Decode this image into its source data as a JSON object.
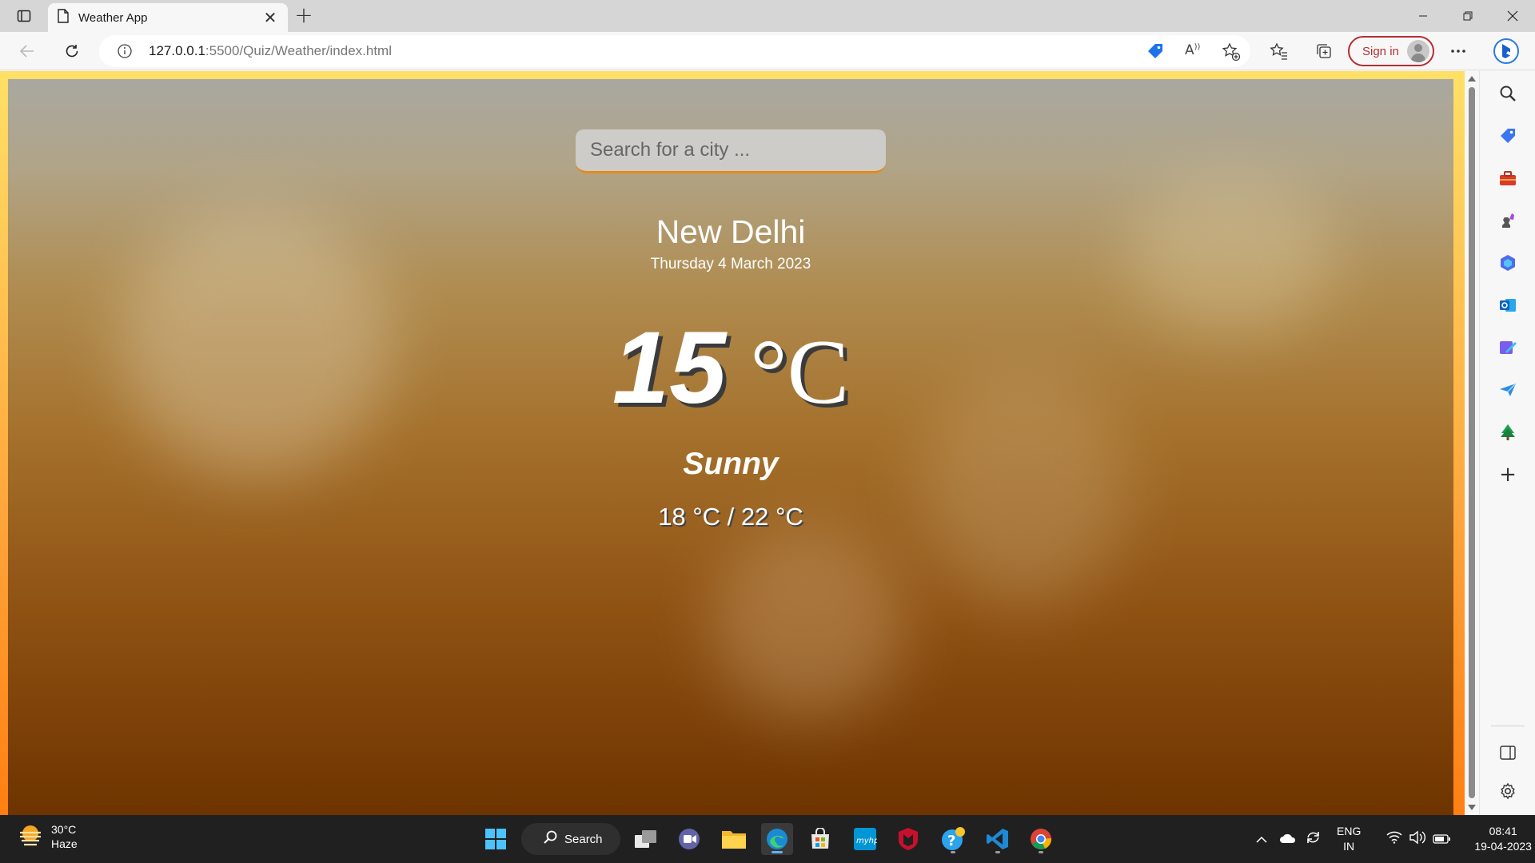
{
  "browser": {
    "tab_title": "Weather App",
    "url_host": "127.0.0.1",
    "url_path": ":5500/Quiz/Weather/index.html",
    "sign_in_label": "Sign in"
  },
  "app": {
    "search_placeholder": "Search for a city ...",
    "city": "New Delhi",
    "date": "Thursday 4 March 2023",
    "temperature": "15",
    "temperature_unit": "°C",
    "condition": "Sunny",
    "min_max": "18 °C / 22 °C"
  },
  "taskbar": {
    "weather_temp": "30°C",
    "weather_condition": "Haze",
    "search_label": "Search",
    "language": "ENG",
    "region": "IN",
    "time": "08:41",
    "date": "19-04-2023"
  },
  "colors": {
    "accent_border": "#e48b18",
    "signin": "#b52e31",
    "taskbar": "#202020"
  }
}
